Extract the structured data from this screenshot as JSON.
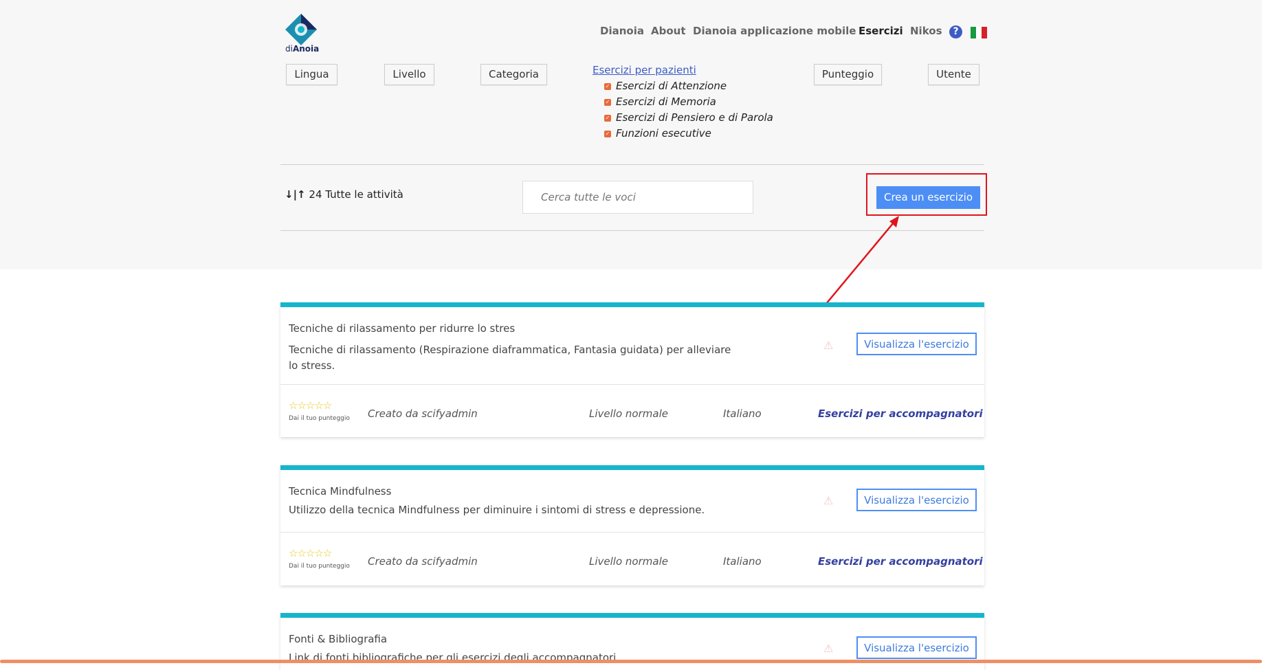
{
  "brand": {
    "logo_prefix": "di",
    "logo_suffix": "Anoia"
  },
  "nav": {
    "items": [
      "Dianoia",
      "About",
      "Dianoia applicazione mobile",
      "Esercizi",
      "Nikos"
    ],
    "help_icon": "question-circle-icon",
    "flag": "italian-flag-icon",
    "active": "Esercizi"
  },
  "filters": {
    "lingua": "Lingua",
    "livello": "Livello",
    "categoria": "Categoria",
    "punteggio": "Punteggio",
    "utente": "Utente"
  },
  "categories": {
    "link": "Esercizi per pazienti",
    "items": [
      "Esercizi di Attenzione",
      "Esercizi di Memoria",
      "Esercizi di Pensiero e di Parola",
      "Funzioni esecutive"
    ]
  },
  "toolbar": {
    "sort_icons": "↓|↑",
    "count_label": "24 Tutte le attività",
    "search_placeholder": "Cerca tutte le voci",
    "create_button": "Crea un esercizio"
  },
  "cards": [
    {
      "title": "Tecniche di rilassamento per ridurre lo stres",
      "desc": "Tecniche di rilassamento (Respirazione diaframmatica, Fantasia guidata) per alleviare lo stress.",
      "view_label": "Visualizza l'esercizio",
      "rate_label": "Dai il tuo punteggio",
      "creator": "Creato da scifyadmin",
      "level": "Livello normale",
      "language": "Italiano",
      "role": "Esercizi per accompagnatori",
      "stars": "☆☆☆☆☆"
    },
    {
      "title": "Tecnica Mindfulness",
      "desc": "Utilizzo della tecnica Mindfulness per diminuire i sintomi di stress e depressione.",
      "view_label": "Visualizza l'esercizio",
      "rate_label": "Dai il tuo punteggio",
      "creator": "Creato da scifyadmin",
      "level": "Livello normale",
      "language": "Italiano",
      "role": "Esercizi per accompagnatori",
      "stars": "☆☆☆☆☆"
    },
    {
      "title": "Fonti & Bibliografia",
      "desc": "Link di fonti bibliografiche per gli esercizi degli accompagnatori",
      "view_label": "Visualizza l'esercizio"
    }
  ],
  "colors": {
    "accent": "#4d8ef5",
    "card_top": "#16b5cc",
    "highlight": "#e0141c"
  }
}
